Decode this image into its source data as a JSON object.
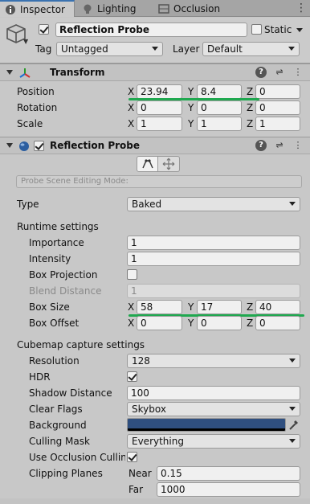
{
  "tabs": [
    {
      "label": "Inspector",
      "icon": "info-icon"
    },
    {
      "label": "Lighting",
      "icon": "bulb-icon"
    },
    {
      "label": "Occlusion",
      "icon": "occlusion-icon"
    }
  ],
  "gameobject": {
    "name": "Reflection Probe",
    "active": true,
    "static_label": "Static",
    "static": false,
    "tag_label": "Tag",
    "tag_value": "Untagged",
    "layer_label": "Layer",
    "layer_value": "Default"
  },
  "transform": {
    "title": "Transform",
    "position_label": "Position",
    "rotation_label": "Rotation",
    "scale_label": "Scale",
    "position": {
      "x": "23.94",
      "y": "8.4",
      "z": "0"
    },
    "rotation": {
      "x": "0",
      "y": "0",
      "z": "0"
    },
    "scale": {
      "x": "1",
      "y": "1",
      "z": "1"
    }
  },
  "axes": {
    "x": "X",
    "y": "Y",
    "z": "Z"
  },
  "probe": {
    "title": "Reflection Probe",
    "enabled": true,
    "mode_label": "Probe Scene Editing Mode:",
    "type_label": "Type",
    "type_value": "Baked",
    "runtime_header": "Runtime settings",
    "importance_label": "Importance",
    "importance": "1",
    "intensity_label": "Intensity",
    "intensity": "1",
    "box_projection_label": "Box Projection",
    "box_projection": false,
    "blend_distance_label": "Blend Distance",
    "blend_distance": "1",
    "box_size_label": "Box Size",
    "box_size": {
      "x": "58",
      "y": "17",
      "z": "40"
    },
    "box_offset_label": "Box Offset",
    "box_offset": {
      "x": "0",
      "y": "0",
      "z": "0"
    },
    "cubemap_header": "Cubemap capture settings",
    "resolution_label": "Resolution",
    "resolution": "128",
    "hdr_label": "HDR",
    "hdr": true,
    "shadow_distance_label": "Shadow Distance",
    "shadow_distance": "100",
    "clear_flags_label": "Clear Flags",
    "clear_flags": "Skybox",
    "background_label": "Background",
    "background_color": "#2f4f7f",
    "culling_mask_label": "Culling Mask",
    "culling_mask": "Everything",
    "use_occlusion_label": "Use Occlusion Culling",
    "use_occlusion": true,
    "clipping_label": "Clipping Planes",
    "near_label": "Near",
    "near": "0.15",
    "far_label": "Far",
    "far": "1000"
  },
  "colors": {
    "accent_tab": "#3a72b0",
    "highlight_green": "#1fa84f"
  }
}
